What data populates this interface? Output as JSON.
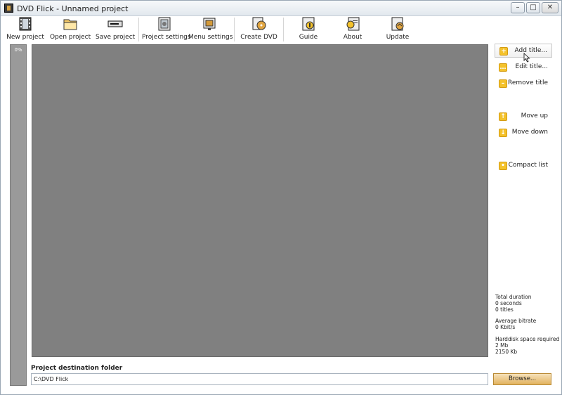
{
  "window": {
    "title": "DVD Flick - Unnamed project",
    "buttons": {
      "minimize": "–",
      "maximize": "□",
      "close": "✕"
    }
  },
  "toolbar": {
    "items": [
      {
        "label": "New project",
        "icon": "film-icon"
      },
      {
        "label": "Open project",
        "icon": "folder-icon"
      },
      {
        "label": "Save project",
        "icon": "drive-icon"
      },
      {
        "label": "Project settings",
        "icon": "settings-icon"
      },
      {
        "label": "Menu settings",
        "icon": "menu-icon"
      },
      {
        "label": "Create DVD",
        "icon": "disc-icon"
      },
      {
        "label": "Guide",
        "icon": "guide-icon"
      },
      {
        "label": "About",
        "icon": "about-icon"
      },
      {
        "label": "Update",
        "icon": "update-icon"
      }
    ]
  },
  "progress": {
    "label": "0%"
  },
  "side": {
    "add_title": "Add title...",
    "edit_title": "Edit title...",
    "remove_title": "Remove title",
    "move_up": "Move up",
    "move_down": "Move down",
    "compact_list": "Compact list"
  },
  "info": {
    "total_duration_label": "Total duration",
    "duration_value": "0 seconds",
    "titles_value": "0 titles",
    "avg_bitrate_label": "Average bitrate",
    "bitrate_value": "0 Kbit/s",
    "hdd_label": "Harddisk space required",
    "hdd_mb": "2 Mb",
    "hdd_kb": "2150 Kb"
  },
  "destination": {
    "label": "Project destination folder",
    "value": "C:\\DVD Flick",
    "browse_label": "Browse..."
  },
  "colors": {
    "accent": "#f4c22b",
    "list_bg": "#808080",
    "browse_bg": "#e8c07a"
  }
}
